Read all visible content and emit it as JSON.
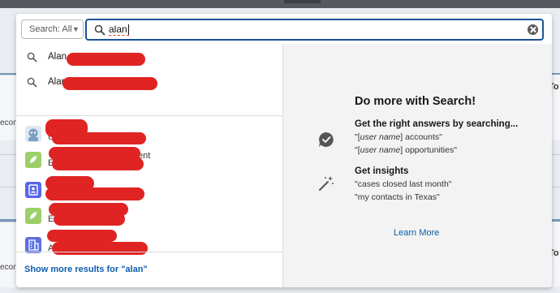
{
  "background": {
    "left_fragment": "econc",
    "right_fragment": "To"
  },
  "search": {
    "scope_label": "Search: All",
    "query": "alan",
    "clear_icon": "clear-icon"
  },
  "suggestions": [
    {
      "icon": "search-icon",
      "text": "Alan"
    },
    {
      "icon": "search-icon",
      "text": "Alan"
    }
  ],
  "records": [
    {
      "icon": "user-icon",
      "visible_text": "U",
      "color": "#8ab2d8"
    },
    {
      "icon": "lead-icon",
      "visible_text": "E",
      "trailing_text": "ent",
      "color": "#9ccf6a"
    },
    {
      "icon": "contact-icon",
      "visible_text": "",
      "color": "#5867e8"
    },
    {
      "icon": "lead-icon",
      "visible_text": "E",
      "trailing_text": "n",
      "color": "#9ccf6a"
    },
    {
      "icon": "account-icon",
      "visible_text": "A",
      "color": "#5a6fe0"
    }
  ],
  "show_more": "Show more results for \"alan\"",
  "promo": {
    "title": "Do more with Search!",
    "sections": [
      {
        "icon": "checkmark-bubble-icon",
        "heading": "Get the right answers by searching...",
        "lines": [
          {
            "prefix": "\"[",
            "emph": "user name",
            "suffix": "] accounts\""
          },
          {
            "prefix": "\"[",
            "emph": "user name",
            "suffix": "] opportunities\""
          }
        ]
      },
      {
        "icon": "magic-wand-icon",
        "heading": "Get insights",
        "lines": [
          {
            "prefix": "\"cases closed last month\"",
            "emph": "",
            "suffix": ""
          },
          {
            "prefix": "\"my contacts in Texas\"",
            "emph": "",
            "suffix": ""
          }
        ]
      }
    ],
    "learn_more": "Learn More"
  },
  "colors": {
    "accent": "#1b5297",
    "link": "#0b5cab",
    "redaction": "#e02424"
  }
}
